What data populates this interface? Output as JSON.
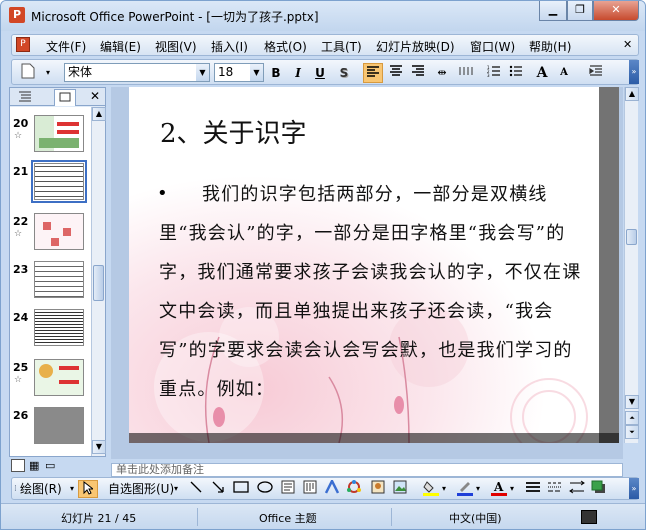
{
  "window": {
    "title": "Microsoft Office PowerPoint - [一切为了孩子.pptx]",
    "app_icon": "P",
    "minimize": "▁",
    "restore": "❐",
    "close": "✕"
  },
  "menu": {
    "items": [
      "文件(F)",
      "编辑(E)",
      "视图(V)",
      "插入(I)",
      "格式(O)",
      "工具(T)",
      "幻灯片放映(D)",
      "窗口(W)",
      "帮助(H)"
    ],
    "close_doc": "✕"
  },
  "format_toolbar": {
    "font_name": "宋体",
    "font_size": "18",
    "bold": "B",
    "italic": "I",
    "underline": "U",
    "shadow": "S",
    "grow_font": "A",
    "shrink_font": "A"
  },
  "sidepane": {
    "tab_outline": "outline-icon",
    "tab_slides": "slides-icon",
    "close": "✕",
    "slides": [
      {
        "num": "20",
        "star": "☆"
      },
      {
        "num": "21",
        "star": ""
      },
      {
        "num": "22",
        "star": "☆"
      },
      {
        "num": "23",
        "star": ""
      },
      {
        "num": "24",
        "star": ""
      },
      {
        "num": "25",
        "star": "☆"
      },
      {
        "num": "26",
        "star": ""
      }
    ],
    "selected": "21"
  },
  "slide": {
    "title": "2、关于识字",
    "bullet": "•",
    "body": "我们的识字包括两部分，一部分是双横线里“我会认”的字，一部分是田字格里“我会写”的字，我们通常要求孩子会读我会认的字，不仅在课文中会读，而且单独提出来孩子还会读，“我会写”的字要求会读会认会写会默，也是我们学习的重点。例如："
  },
  "notes": {
    "text": "单击此处添加备注"
  },
  "draw_toolbar": {
    "draw_label": "绘图(R)",
    "autoshapes_label": "自选图形(U)"
  },
  "status": {
    "slide_info": "幻灯片 21 / 45",
    "theme": "Office 主题",
    "language": "中文(中国)"
  },
  "colors": {
    "accent_select": "#3d6fc4",
    "fill_yellow": "#ffff00",
    "line_blue": "#1f3fd8",
    "font_red": "#e00000",
    "toggle_on": "#f9c672"
  }
}
